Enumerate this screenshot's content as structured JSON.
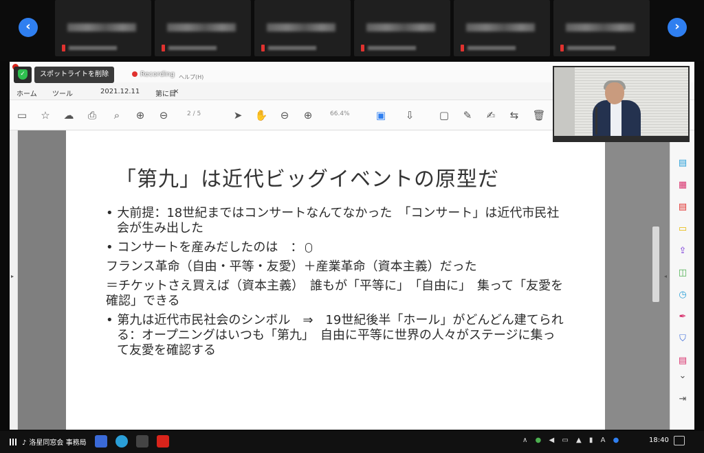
{
  "zoom": {
    "nav_left": "‹",
    "nav_right": "›",
    "spotlight_button": "スポットライトを削除",
    "recording_label": "Recording",
    "participant_name": "洛星同窓会 事務局",
    "colors": {
      "nav_blue": "#2f7ff0",
      "record_red": "#e0322f",
      "shield_green": "#2fbf4f"
    }
  },
  "acrobat": {
    "tabs": {
      "home": "ホーム",
      "tools": "ツール",
      "doc_tab": "2021.12.11",
      "doc_tab2": "第に目",
      "close": "×"
    },
    "menu_item": "ヘルプ(H)",
    "page_indicator": "2 / 5",
    "zoom_level": "66.4%",
    "toolbar_icons": [
      "save-icon",
      "star-icon",
      "cloud-upload-icon",
      "print-icon",
      "search-icon",
      "page-up-icon",
      "page-down-icon",
      "cursor-icon",
      "hand-icon",
      "zoom-out-icon",
      "zoom-in-icon",
      "fit-page-icon",
      "scroll-icon",
      "comment-icon",
      "pen-icon",
      "sign-icon",
      "share-icon",
      "trash-icon"
    ]
  },
  "slide": {
    "title": "「第九」は近代ビッグイベントの原型だ",
    "bullets": [
      "• 大前提：18世紀まではコンサートなんてなかった　「コンサート」は近代市民社会が生み出した",
      "• コンサートを産みだしたのは　："
    ],
    "lines": [
      "フランス革命（自由・平等・友愛）＋産業革命（資本主義）だった",
      "＝チケットさえ買えば（資本主義）　誰もが「平等に」　「自由に」　集って「友愛を確認」できる"
    ],
    "last_bullet": "• 第九は近代市民社会のシンボル　⇒　19世紀後半「ホール」がどんどん建てられる：オープニングはいつも「第九」　自由に平等に世界の人々がステージに集って友愛を確認する"
  },
  "taskbar": {
    "time": "18:40",
    "ime": "A"
  }
}
